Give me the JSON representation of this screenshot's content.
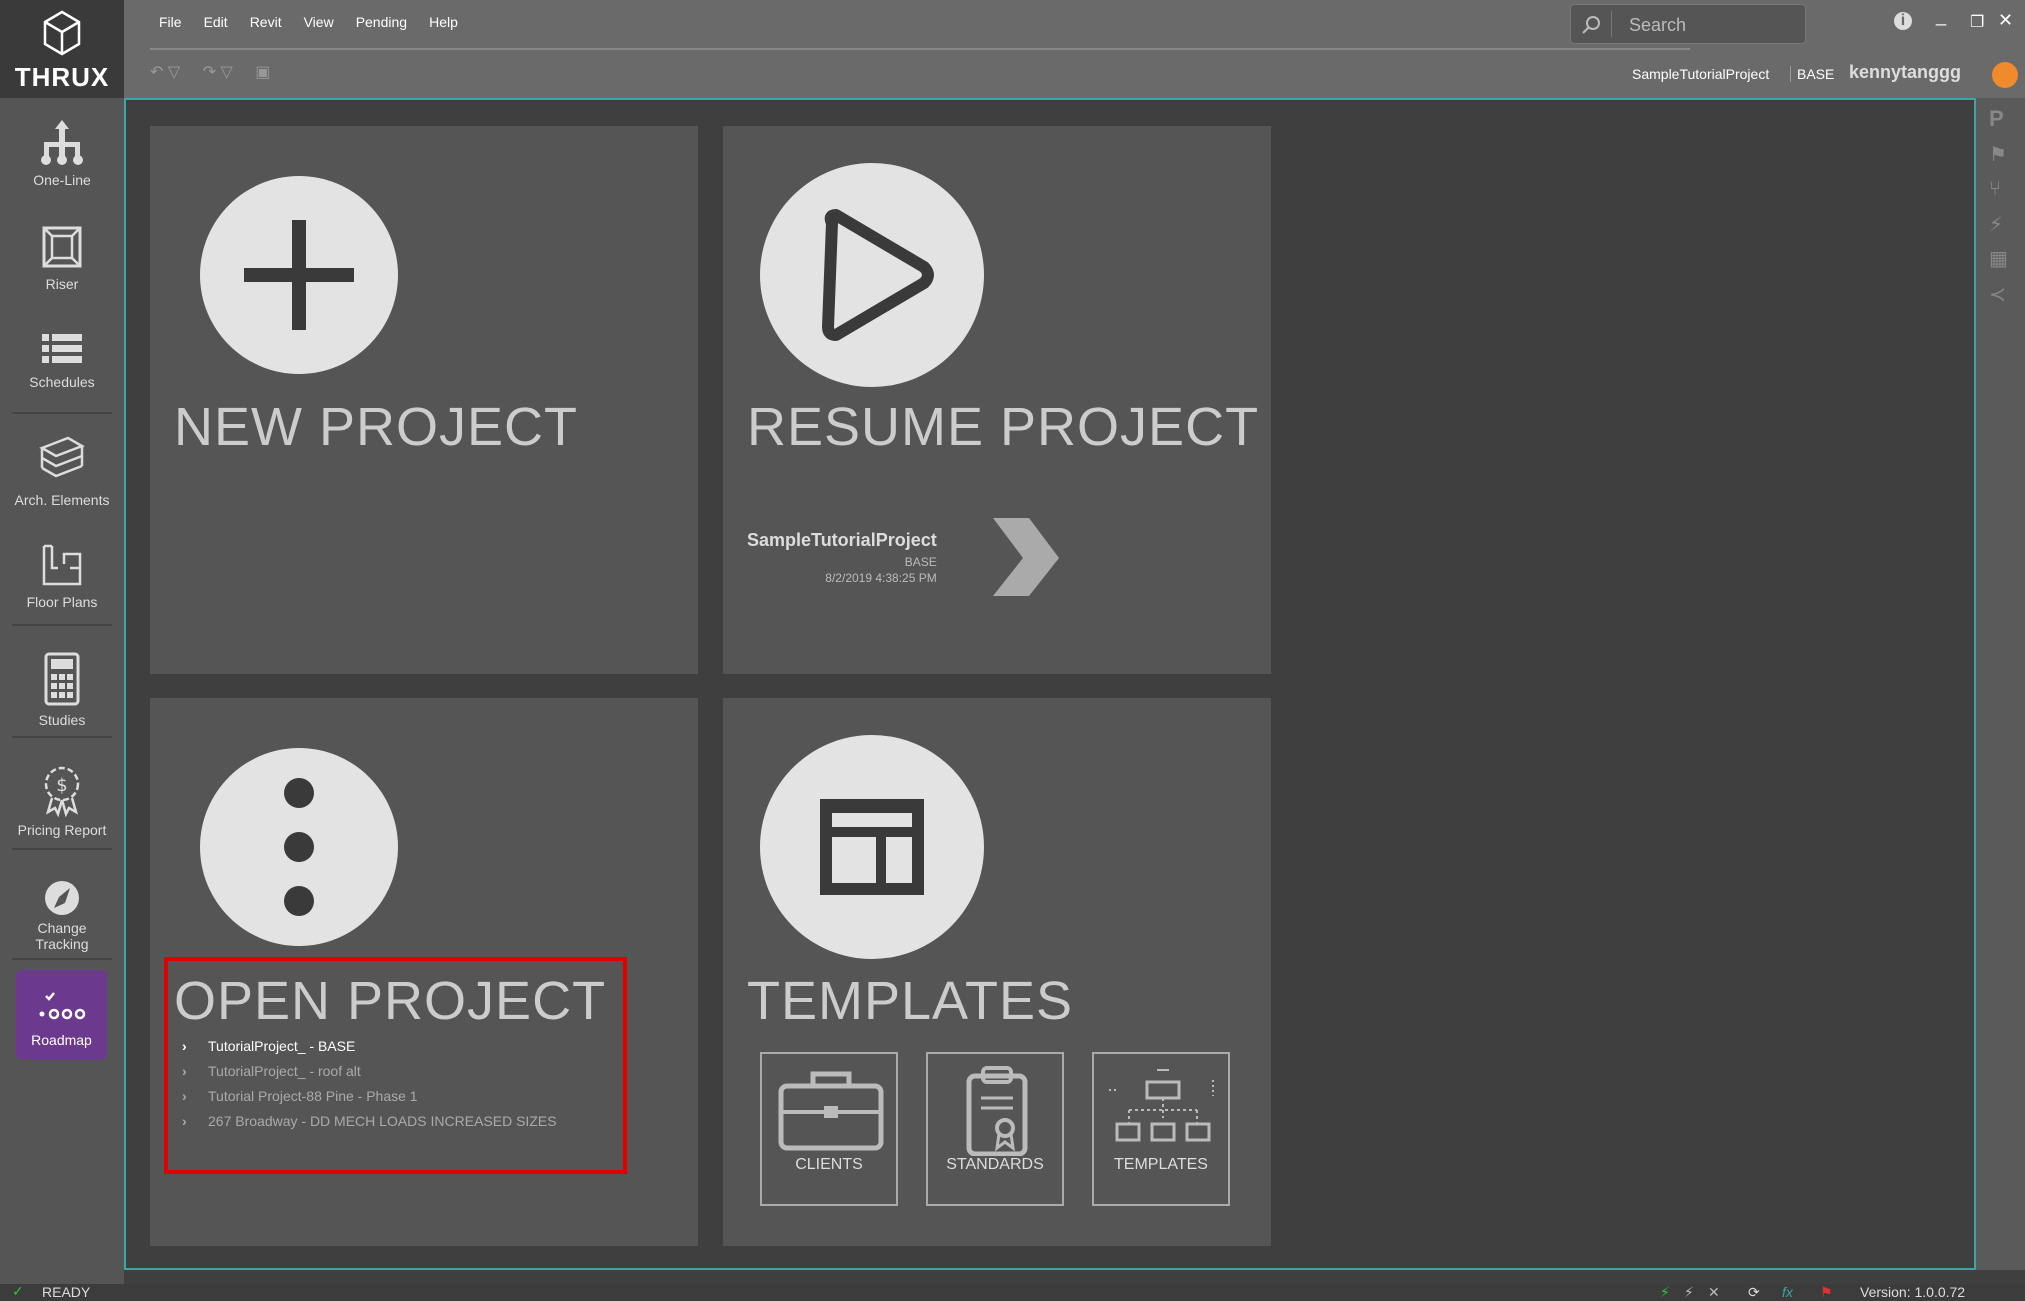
{
  "app": {
    "brand": "THRUX"
  },
  "menu": [
    "File",
    "Edit",
    "Revit",
    "View",
    "Pending",
    "Help"
  ],
  "search": {
    "placeholder": "Search"
  },
  "header": {
    "project_name": "SampleTutorialProject",
    "branch": "BASE",
    "username": "kennytanggg"
  },
  "sidebar": {
    "items": [
      {
        "label": "One-Line",
        "icon": "one-line-icon"
      },
      {
        "label": "Riser",
        "icon": "riser-icon"
      },
      {
        "label": "Schedules",
        "icon": "schedules-icon"
      },
      {
        "label": "Arch. Elements",
        "icon": "arch-elements-icon"
      },
      {
        "label": "Floor Plans",
        "icon": "floor-plans-icon"
      },
      {
        "label": "Studies",
        "icon": "studies-icon"
      },
      {
        "label": "Pricing Report",
        "icon": "pricing-report-icon"
      },
      {
        "label_line1": "Change",
        "label_line2": "Tracking",
        "icon": "change-tracking-icon"
      },
      {
        "label": "Roadmap",
        "icon": "roadmap-icon"
      }
    ]
  },
  "tiles": {
    "new_project": {
      "title": "NEW PROJECT"
    },
    "resume_project": {
      "title": "RESUME PROJECT",
      "recent": {
        "name": "SampleTutorialProject",
        "branch": "BASE",
        "date": "8/2/2019 4:38:25 PM"
      }
    },
    "open_project": {
      "title": "OPEN PROJECT",
      "items": [
        "TutorialProject_ - BASE",
        "TutorialProject_ - roof alt",
        "Tutorial Project-88 Pine - Phase 1",
        "267 Broadway - DD MECH LOADS INCREASED SIZES"
      ]
    },
    "templates": {
      "title": "TEMPLATES",
      "buttons": [
        "CLIENTS",
        "STANDARDS",
        "TEMPLATES"
      ]
    }
  },
  "status": {
    "text": "READY",
    "version_label": "Version:",
    "version": "1.0.0.72"
  },
  "colors": {
    "accent_border": "#3aa6a6",
    "roadmap": "#6b3a8e",
    "highlight": "#e00000",
    "avatar": "#f08a2c",
    "ready": "#31c531"
  }
}
